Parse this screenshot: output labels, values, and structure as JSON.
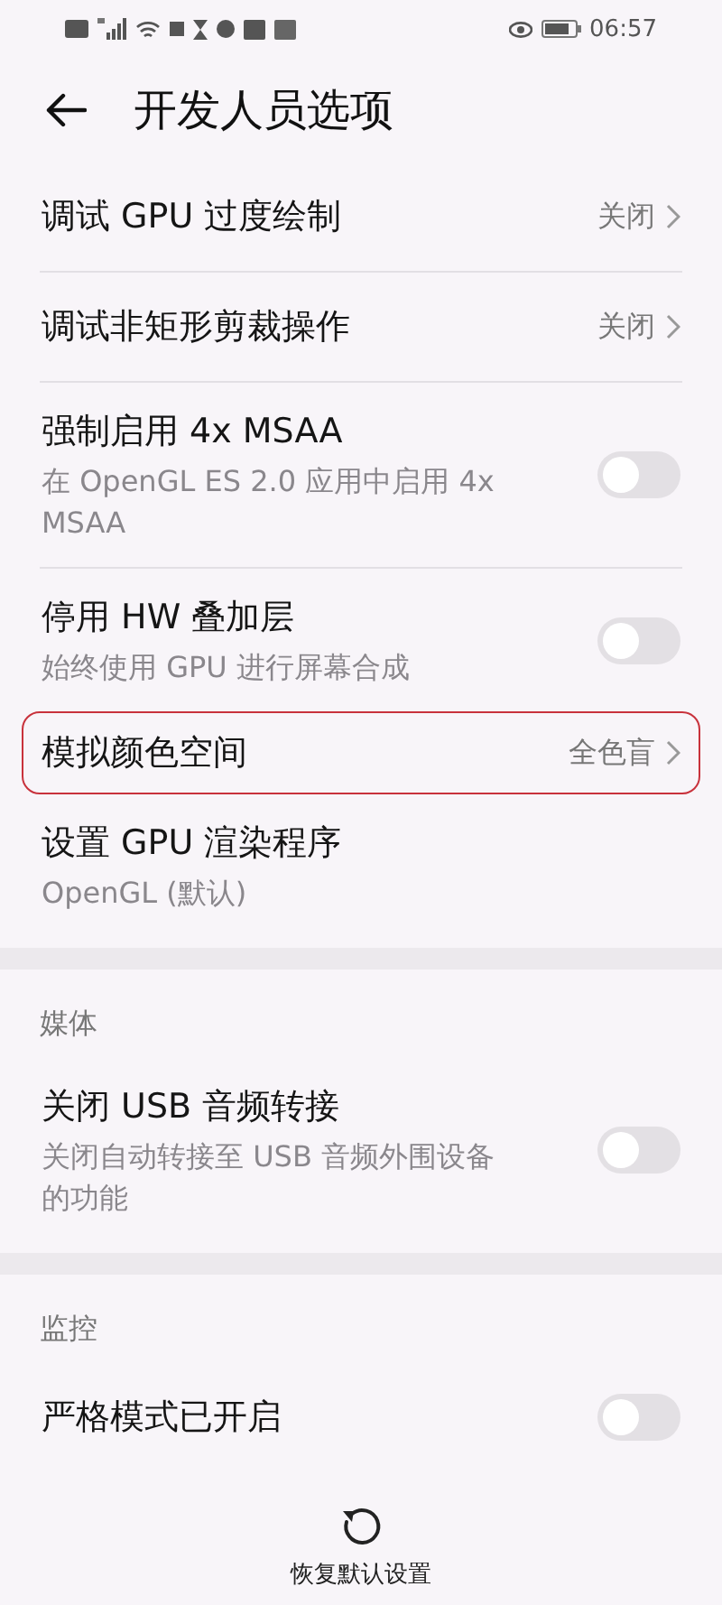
{
  "status_bar": {
    "time": "06:57"
  },
  "header": {
    "title": "开发人员选项"
  },
  "sections": [
    {
      "items": [
        {
          "kind": "link",
          "title": "调试 GPU 过度绘制",
          "value": "关闭",
          "highlighted": false
        },
        {
          "kind": "link",
          "title": "调试非矩形剪裁操作",
          "value": "关闭",
          "highlighted": false
        },
        {
          "kind": "toggle",
          "title": "强制启用 4x MSAA",
          "subtitle": "在 OpenGL ES 2.0 应用中启用 4x MSAA",
          "on": false,
          "highlighted": false
        },
        {
          "kind": "toggle",
          "title": "停用 HW 叠加层",
          "subtitle": "始终使用 GPU 进行屏幕合成",
          "on": false,
          "highlighted": false
        },
        {
          "kind": "link",
          "title": "模拟颜色空间",
          "value": "全色盲",
          "highlighted": true
        },
        {
          "kind": "info",
          "title": "设置 GPU 渲染程序",
          "subtitle": "OpenGL (默认)",
          "highlighted": false
        }
      ]
    },
    {
      "title": "媒体",
      "items": [
        {
          "kind": "toggle",
          "title": "关闭 USB 音频转接",
          "subtitle": "关闭自动转接至 USB 音频外围设备的功能",
          "on": false,
          "highlighted": false
        }
      ]
    },
    {
      "title": "监控",
      "items": [
        {
          "kind": "toggle",
          "title": "严格模式已开启",
          "on": false,
          "highlighted": false
        }
      ]
    }
  ],
  "bottom_bar": {
    "label": "恢复默认设置"
  }
}
